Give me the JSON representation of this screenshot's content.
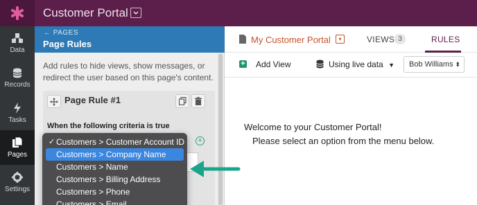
{
  "app": {
    "title": "Customer Portal"
  },
  "nav": [
    {
      "label": "Data",
      "icon": "data-icon"
    },
    {
      "label": "Records",
      "icon": "records-icon"
    },
    {
      "label": "Tasks",
      "icon": "tasks-icon"
    },
    {
      "label": "Pages",
      "icon": "pages-icon",
      "active": true
    },
    {
      "label": "Settings",
      "icon": "settings-icon"
    }
  ],
  "panel": {
    "back_label": "← PAGES",
    "title": "Page Rules",
    "description": "Add rules to hide views, show messages, or redirect the user based on this page's content.",
    "rule": {
      "title": "Page Rule #1",
      "criteria_label": "When the following criteria is true"
    }
  },
  "dropdown": {
    "options": [
      "Customers > Customer Account ID",
      "Customers > Company Name",
      "Customers > Name",
      "Customers > Billing Address",
      "Customers > Phone",
      "Customers > Email"
    ],
    "checked": "Customers > Customer Account ID",
    "highlighted": "Customers > Company Name"
  },
  "header": {
    "page_name": "My Customer Portal",
    "tabs": [
      {
        "label": "VIEWS",
        "badge": "3"
      },
      {
        "label": "RULES",
        "active": true
      }
    ]
  },
  "toolbar": {
    "add_view": "Add View",
    "live_data": "Using live data",
    "user": "Bob Williams"
  },
  "canvas": {
    "welcome": "Welcome to your Customer Portal!",
    "instructions": "Please select an option from the menu below."
  },
  "colors": {
    "topbar": "#5c1e4a",
    "panel_header": "#2d7ab6",
    "accent": "#c1522b",
    "add_green": "#23936a",
    "highlight": "#3b86de",
    "arrow": "#1aa58a"
  }
}
